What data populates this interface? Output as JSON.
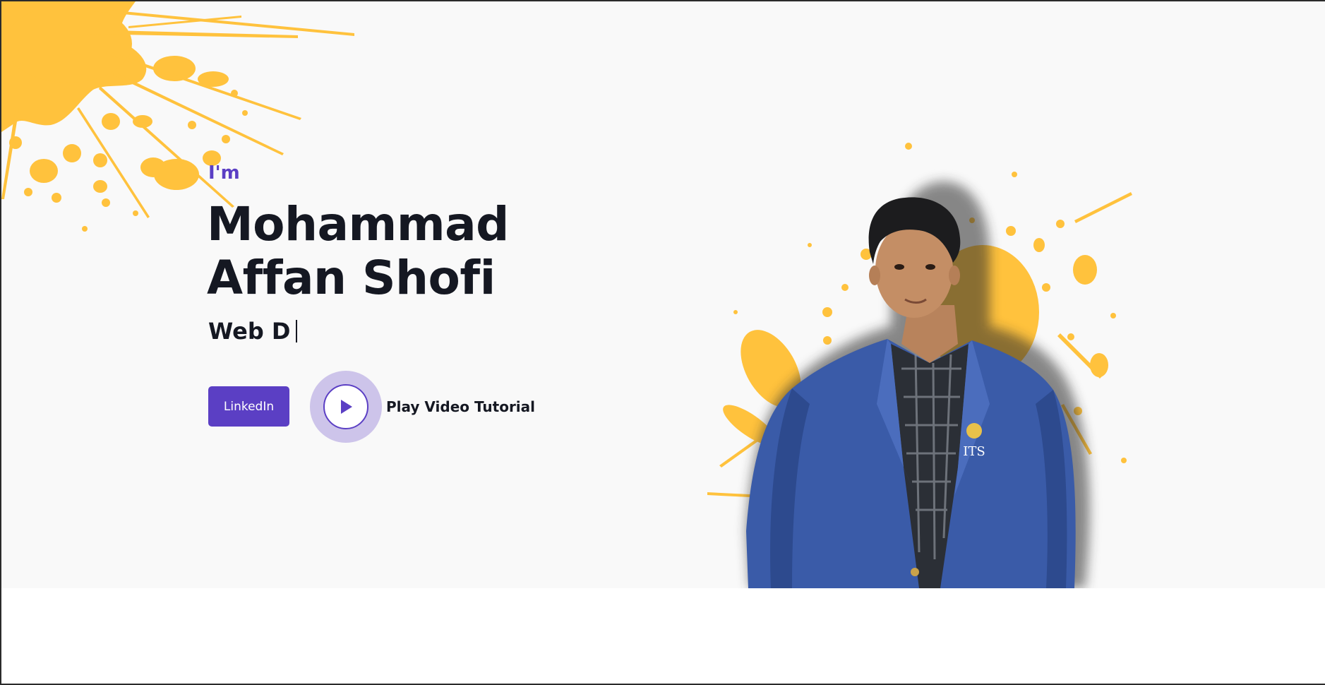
{
  "hero": {
    "intro": "I'm",
    "name": "Mohammad Affan Shofi",
    "role_typed": "Web D",
    "linkedin_label": "LinkedIn",
    "play_label": "Play Video Tutorial"
  },
  "portrait": {
    "jacket_text": "ITS"
  },
  "colors": {
    "accent": "#5b3fc4",
    "splash": "#ffc23d",
    "hero_bg": "#f9f9f9",
    "text_dark": "#151822"
  },
  "icons": {
    "play": "play-icon",
    "splash": "paint-splash",
    "avatar": "portrait-photo"
  }
}
